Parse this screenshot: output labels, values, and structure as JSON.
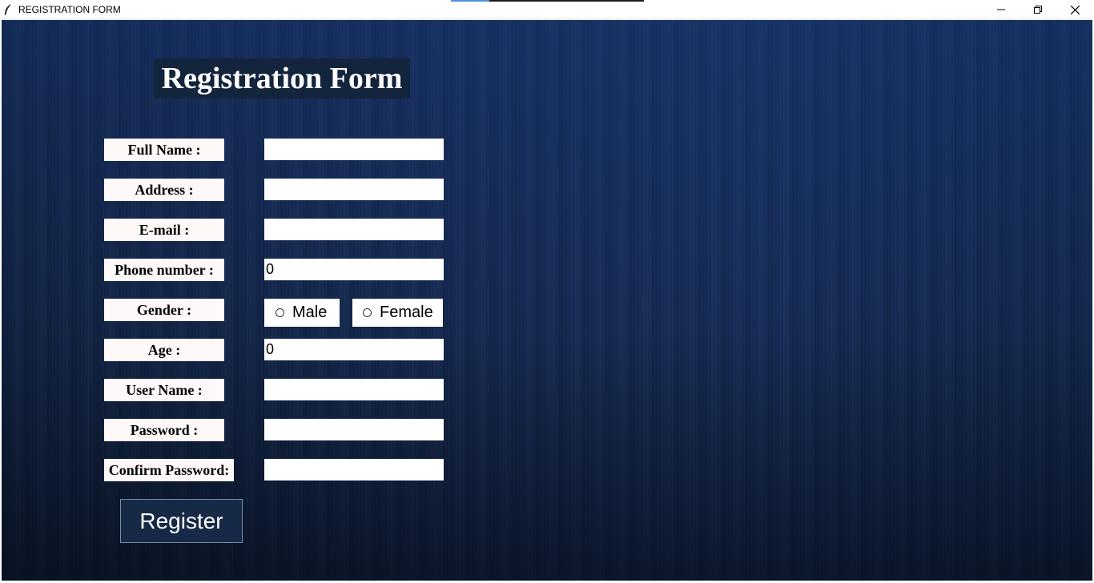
{
  "window": {
    "title": "REGISTRATION FORM",
    "controls": [
      "minimize-icon",
      "restore-icon",
      "close-icon"
    ]
  },
  "colors": {
    "background_top": "#1c3a72",
    "background_bottom": "#0a1424",
    "title_bg": "#13243d",
    "label_bg": "#fff8f8",
    "button_bg": "#162a47"
  },
  "form": {
    "title": "Registration Form",
    "fields": {
      "full_name": {
        "label": "Full Name :",
        "value": ""
      },
      "address": {
        "label": "Address :",
        "value": ""
      },
      "email": {
        "label": "E-mail :",
        "value": ""
      },
      "phone": {
        "label": "Phone number :",
        "value": "0"
      },
      "gender": {
        "label": "Gender :",
        "options": [
          "Male",
          "Female"
        ],
        "selected": null
      },
      "age": {
        "label": "Age :",
        "value": "0"
      },
      "username": {
        "label": "User Name :",
        "value": ""
      },
      "password": {
        "label": "Password :",
        "value": ""
      },
      "confirm_password": {
        "label": "Confirm Password:",
        "value": ""
      }
    },
    "submit_label": "Register"
  }
}
